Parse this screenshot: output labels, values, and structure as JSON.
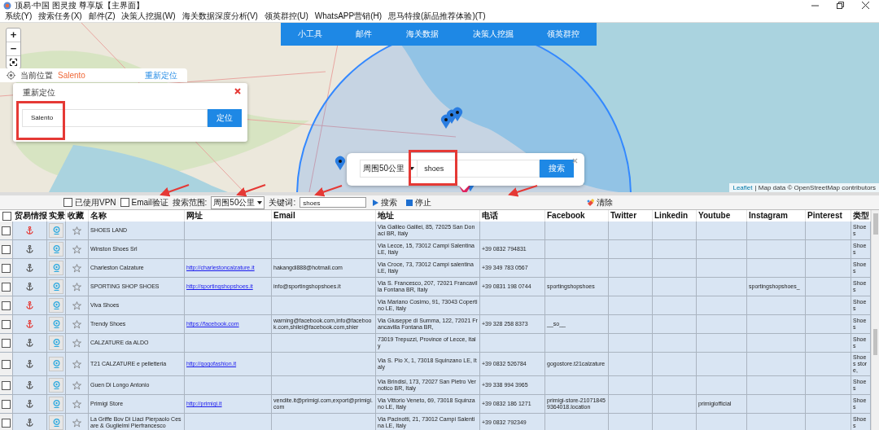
{
  "window": {
    "title": "顶易·中国 图灵搜 尊享版【主界面】"
  },
  "menu": [
    "系统(Y)",
    "搜索任务(X)",
    "邮件(Z)",
    "决策人挖掘(W)",
    "海关数据深度分析(V)",
    "领英群控(U)",
    "WhatsAPP营销(H)",
    "思马特搜(新品推荐体验)(T)"
  ],
  "map": {
    "zoom_controls": [
      "+",
      "−"
    ],
    "nav": [
      "小工具",
      "邮件",
      "海关数据",
      "决策人挖掘",
      "领英群控"
    ],
    "current_location": {
      "label": "当前位置",
      "value": "Salento",
      "action": "重新定位"
    },
    "relocate_dialog": {
      "title": "重新定位",
      "value": "Salento",
      "button": "定位",
      "highlighted": true
    },
    "search_popup": {
      "radius": "周围50公里",
      "keyword": "shoes",
      "button": "搜索",
      "highlighted": true
    },
    "attribution": {
      "link": "Leaflet",
      "text": "| Map data © OpenStreetMap contributors"
    }
  },
  "filters": {
    "vpn": {
      "label": "已使用VPN",
      "checked": false
    },
    "email_verify": {
      "label": "Email验证",
      "checked": false
    },
    "range_label": "搜索范围:",
    "range": "周围50公里",
    "keyword_label": "关键词:",
    "keyword": "shoes",
    "search": "搜索",
    "stop": "停止",
    "clear": "清除"
  },
  "table": {
    "select_all": false,
    "columns": [
      "贸易情报",
      "实景",
      "收藏",
      "名称",
      "网址",
      "Email",
      "地址",
      "电话",
      "Facebook",
      "Twitter",
      "Linkedin",
      "Youtube",
      "Instagram",
      "Pinterest",
      "类型"
    ],
    "rows": [
      {
        "checked": false,
        "trade_flag": true,
        "favorite": false,
        "name": "SHOES LAND",
        "address": "Via Galileo Galilei, 85, 72025 San Donaci BR, Italy",
        "type": "Shoe s"
      },
      {
        "checked": false,
        "trade_flag": false,
        "favorite": false,
        "name": "Winston Shoes Srl",
        "address": "Via Lecce, 15, 73012 Campi Salentina LE, Italy",
        "phone": "+39 0832 794831",
        "type": "Shoe s"
      },
      {
        "checked": false,
        "trade_flag": false,
        "favorite": false,
        "name": "Charleston Calzature",
        "website": "http://charlestoncalzature.it",
        "email": "hakangdi888@hotmail.com",
        "address": "Via Croce, 73, 73012 Campi salentina LE, Italy",
        "phone": "+39 349 783 0567",
        "type": "Shoe s"
      },
      {
        "checked": false,
        "trade_flag": false,
        "favorite": false,
        "name": "SPORTING SHOP SHOES",
        "website": "http://sportingshopshoes.it",
        "email": "info@sportingshopshoes.it",
        "address": "Via S. Francesco, 207, 72021 Francavilla Fontana BR, Italy",
        "phone": "+39 0831 198 0744",
        "facebook": "sportingshopshoes",
        "instagram": "sportingshopshoes_",
        "type": "Shoe s"
      },
      {
        "checked": false,
        "trade_flag": true,
        "favorite": false,
        "name": "Viva Shoes",
        "address": "Via Mariano Cosimo, 91, 73043 Copertino LE, Italy",
        "type": "Shoe s"
      },
      {
        "checked": false,
        "trade_flag": true,
        "favorite": false,
        "name": "Trendy Shoes",
        "website": "https://facebook.com",
        "email": "warning@facebook.com,info@facebook.com,shilei@facebook.com,shier",
        "address": "Via Giuseppe di Summa, 122, 72021 Francavilla Fontana BR,",
        "phone": "+39 328 258 8373",
        "facebook": "__so__",
        "type": "Shoe s"
      },
      {
        "checked": false,
        "trade_flag": false,
        "favorite": false,
        "name": "CALZATURE da ALDO",
        "address": "73019 Trepuzzi, Province of Lecce, Italy",
        "type": "Shoe s"
      },
      {
        "checked": false,
        "trade_flag": false,
        "favorite": false,
        "name": "T21 CALZATURE e pelletteria",
        "website": "http://gogofashion.it",
        "address": "Via S. Pio X, 1, 73018 Squinzano LE, Italy",
        "phone": "+39 0832 526784",
        "facebook": "gogostore.t21calzature",
        "type": "Shoe s store,"
      },
      {
        "checked": false,
        "trade_flag": false,
        "favorite": false,
        "name": "Guen Di Longo Antonio",
        "address": "Via Brindisi, 173, 72027 San Pietro Vernotico BR, Italy",
        "phone": "+39 338 994 3965",
        "type": "Shoe s"
      },
      {
        "checked": false,
        "trade_flag": false,
        "favorite": false,
        "name": "Primigi Store",
        "website": "http://primigi.it",
        "email": "vendite.it@primigi.com,export@primigi.com",
        "address": "Via Vittorio Veneto, 69, 73018 Squinzano LE, Italy",
        "phone": "+39 0832 186 1271",
        "facebook": "primigi-store-210718459364018.location",
        "youtube": "primigiofficial",
        "type": "Shoe s"
      },
      {
        "checked": false,
        "trade_flag": false,
        "favorite": false,
        "name": "La Griffe Bov Di Liaci Pierpaolo Cesare & Guglielmi Pierfrancesco",
        "address": "Via Pacinotti, 21, 73012 Campi Salentina LE, Italy",
        "phone": "+39 0832 792349",
        "type": "Shoe s"
      }
    ]
  }
}
